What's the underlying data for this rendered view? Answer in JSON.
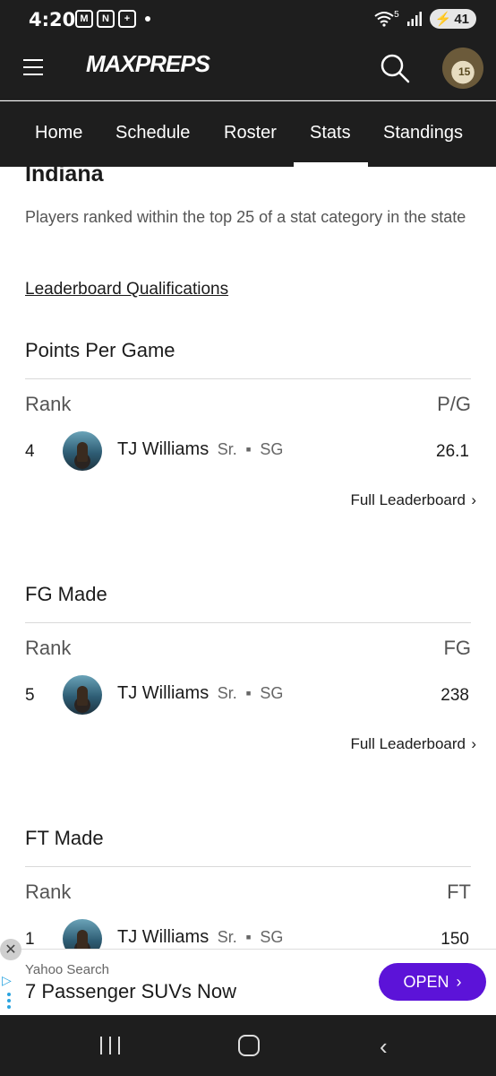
{
  "status_bar": {
    "time": "4:20",
    "notif_icons": [
      "M",
      "N",
      "+"
    ],
    "battery": "41",
    "signal_label": "5"
  },
  "header": {
    "logo_text": "MAXPREPS",
    "avatar_jersey": "15"
  },
  "tabs": [
    "Home",
    "Schedule",
    "Roster",
    "Stats",
    "Standings"
  ],
  "active_tab": "Stats",
  "content": {
    "state_title": "Indiana",
    "description": "Players ranked within the top 25 of a stat category in the state",
    "qualifications_link": "Leaderboard Qualifications",
    "full_leaderboard_label": "Full Leaderboard",
    "rank_header": "Rank",
    "sections": [
      {
        "title": "Points Per Game",
        "stat_header": "P/G",
        "rank": "4",
        "player": "TJ Williams",
        "class": "Sr.",
        "position": "SG",
        "value": "26.1"
      },
      {
        "title": "FG Made",
        "stat_header": "FG",
        "rank": "5",
        "player": "TJ Williams",
        "class": "Sr.",
        "position": "SG",
        "value": "238"
      },
      {
        "title": "FT Made",
        "stat_header": "FT",
        "rank": "1",
        "player": "TJ Williams",
        "class": "Sr.",
        "position": "SG",
        "value": "150"
      }
    ]
  },
  "ad": {
    "source": "Yahoo Search",
    "headline": "7 Passenger SUVs Now",
    "button_label": "OPEN",
    "button_color": "#5c13d8"
  }
}
